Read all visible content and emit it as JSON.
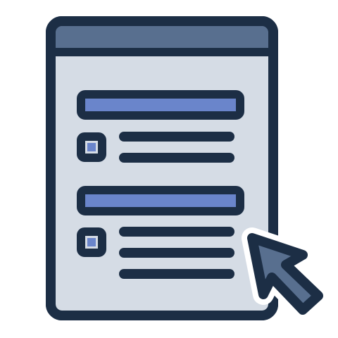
{
  "icon": {
    "semantic_name": "form-document-with-cursor-icon",
    "cursor_icon": "mouse-pointer-icon",
    "colors": {
      "outline": "#1c2e45",
      "page_fill": "#d5dce5",
      "header_fill": "#586f8f",
      "accent_bar": "#6a85cb",
      "checkbox_fill": "#6a85cb",
      "cursor_fill": "#586f8f",
      "background": "#ffffff"
    },
    "sections": [
      {
        "title_bar": "accent",
        "checkbox": "checked",
        "text_lines": 2
      },
      {
        "title_bar": "accent",
        "checkbox": "checked",
        "text_lines": 3
      }
    ]
  }
}
